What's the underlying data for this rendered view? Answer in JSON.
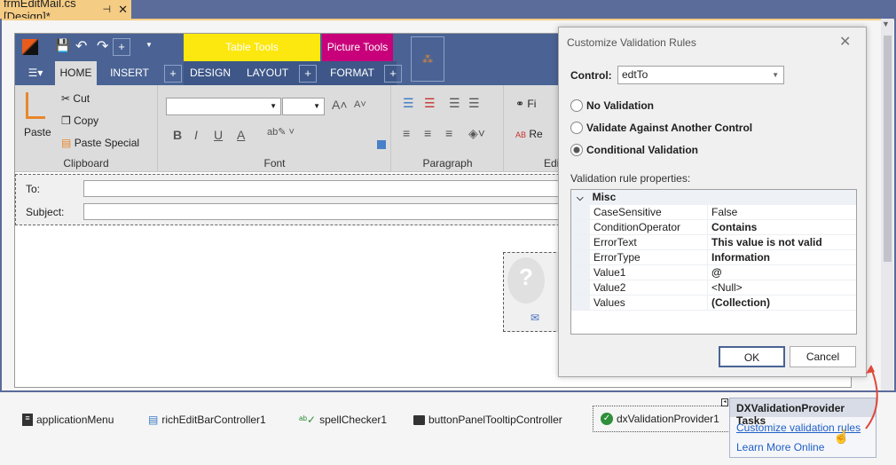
{
  "document_tab": {
    "title": "frmEditMail.cs [Design]*",
    "pin_icon": "pin-icon",
    "close_icon": "close-icon"
  },
  "ribbon": {
    "contextual": [
      {
        "label": "Table Tools",
        "color": "#fce70f"
      },
      {
        "label": "Picture Tools",
        "color": "#c8007a"
      }
    ],
    "tabs": [
      "HOME",
      "INSERT",
      "DESIGN",
      "LAYOUT",
      "FORMAT"
    ],
    "clipboard": {
      "paste": "Paste",
      "cut": "Cut",
      "copy": "Copy",
      "paste_special": "Paste Special",
      "label": "Clipboard"
    },
    "font": {
      "label": "Font",
      "bold": "B",
      "italic": "I",
      "underline": "U",
      "color": "A"
    },
    "paragraph": {
      "label": "Paragraph"
    },
    "editing": {
      "find": "Fi",
      "replace": "Re",
      "label": "Edit"
    }
  },
  "mail": {
    "to_label": "To:",
    "subject_label": "Subject:",
    "to_value": "",
    "subject_value": ""
  },
  "dialog": {
    "title": "Customize Validation Rules",
    "control_label": "Control:",
    "control_value": "edtTo",
    "options": [
      {
        "label": "No Validation",
        "selected": false
      },
      {
        "label": "Validate Against Another Control",
        "selected": false
      },
      {
        "label": "Conditional Validation",
        "selected": true
      }
    ],
    "props_label": "Validation rule properties:",
    "category": "Misc",
    "properties": [
      {
        "name": "CaseSensitive",
        "value": "False",
        "bold": false
      },
      {
        "name": "ConditionOperator",
        "value": "Contains",
        "bold": true
      },
      {
        "name": "ErrorText",
        "value": "This value is not valid",
        "bold": true
      },
      {
        "name": "ErrorType",
        "value": "Information",
        "bold": true
      },
      {
        "name": "Value1",
        "value": "@",
        "bold": true
      },
      {
        "name": "Value2",
        "value": "<Null>",
        "bold": false
      },
      {
        "name": "Values",
        "value": "(Collection)",
        "bold": true
      }
    ],
    "ok": "OK",
    "cancel": "Cancel"
  },
  "tray": {
    "components": [
      "applicationMenu",
      "richEditBarController1",
      "spellChecker1",
      "buttonPanelTooltipController",
      "dxValidationProvider1"
    ]
  },
  "tasks": {
    "title": "DXValidationProvider Tasks",
    "customize": "Customize validation rules",
    "learn": "Learn More Online"
  }
}
